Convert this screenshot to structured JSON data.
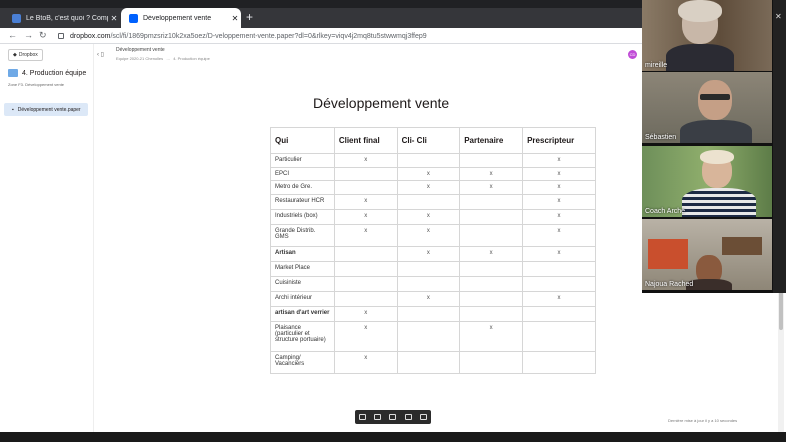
{
  "browser": {
    "tabs": [
      {
        "title": "Le BtoB, c'est quoi ? Comprendre",
        "active": false
      },
      {
        "title": "Développement vente",
        "active": true
      }
    ],
    "url_host": "dropbox.com",
    "url_path": "/scl/fi/1869pmzsriz10k2xa5oez/D-veloppement-vente.paper?dl=0&rlkey=viqv4j2mq8tu5stwwmqj3ffep9"
  },
  "sidebar": {
    "dropbox_button": "Dropbox",
    "folder": "4. Production équipe",
    "folder_sub": "Zone F3. Développement vente",
    "doc": "Développement vente.paper"
  },
  "header": {
    "doc_title": "Développement vente",
    "crumb_team": "Equipe 2020-21 Chenolles",
    "crumb_sep": "...",
    "crumb_folder": "4. Production équipe",
    "avatar_initials": "CD"
  },
  "doc": {
    "title": "Développement vente",
    "columns": [
      "Qui",
      "Client final",
      "Cli- Cli",
      "Partenaire",
      "Prescripteur"
    ],
    "rows": [
      {
        "label": "Particulier",
        "bold": false,
        "marks": [
          true,
          false,
          false,
          true
        ]
      },
      {
        "label": "EPCI",
        "bold": false,
        "marks": [
          false,
          true,
          true,
          true
        ]
      },
      {
        "label": "Metro de Gre.",
        "bold": false,
        "marks": [
          false,
          true,
          true,
          true
        ]
      },
      {
        "label": "Restaurateur HCR",
        "bold": false,
        "marks": [
          true,
          false,
          false,
          true
        ]
      },
      {
        "label": "Industriels (box)",
        "bold": false,
        "marks": [
          true,
          true,
          false,
          true
        ]
      },
      {
        "label": "Grande Distrib. GMS",
        "bold": false,
        "marks": [
          true,
          true,
          false,
          true
        ]
      },
      {
        "label": "Artisan",
        "bold": true,
        "marks": [
          false,
          true,
          true,
          true
        ]
      },
      {
        "label": "Market Place",
        "bold": false,
        "marks": [
          false,
          false,
          false,
          false
        ]
      },
      {
        "label": "Cuisiniste",
        "bold": false,
        "marks": [
          false,
          false,
          false,
          false
        ]
      },
      {
        "label": "Archi intérieur",
        "bold": false,
        "marks": [
          false,
          true,
          false,
          true
        ]
      },
      {
        "label": "artisan d'art verrier",
        "bold": true,
        "marks": [
          true,
          false,
          false,
          false
        ]
      },
      {
        "label": "Plaisance (particulier et structure portuaire)",
        "bold": false,
        "marks": [
          true,
          false,
          true,
          false
        ]
      },
      {
        "label": "Camping/ Vacanciers",
        "bold": false,
        "marks": [
          true,
          false,
          false,
          false
        ]
      }
    ],
    "mark_char": "x"
  },
  "footer": {
    "updated": "Dernière mise à jour il y a 10 secondes"
  },
  "video": {
    "participants": [
      "mireille",
      "Sébastien",
      "Coach Arche",
      "Najoua Rached"
    ]
  }
}
